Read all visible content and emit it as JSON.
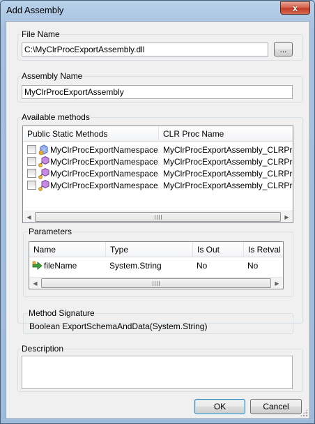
{
  "window": {
    "title": "Add Assembly",
    "close_glyph": "x"
  },
  "file_name": {
    "label": "File Name",
    "value": "C:\\MyClrProcExportAssembly.dll",
    "browse_label": "..."
  },
  "assembly_name": {
    "label": "Assembly Name",
    "value": "MyClrProcExportAssembly"
  },
  "available_methods": {
    "label": "Available methods",
    "columns": [
      "Public Static Methods",
      "CLR Proc Name"
    ],
    "rows": [
      {
        "method": "MyClrProcExportNamespace.C...",
        "proc": "MyClrProcExportAssembly_CLRProce...",
        "icon": "method-icon-blue",
        "checked": false
      },
      {
        "method": "MyClrProcExportNamespace.C...",
        "proc": "MyClrProcExportAssembly_CLRProce...",
        "icon": "method-icon-purple",
        "checked": false
      },
      {
        "method": "MyClrProcExportNamespace.C...",
        "proc": "MyClrProcExportAssembly_CLRProce...",
        "icon": "method-icon-purple",
        "checked": false
      },
      {
        "method": "MyClrProcExportNamespace.C...",
        "proc": "MyClrProcExportAssembly_CLRProce...",
        "icon": "method-icon-purple",
        "checked": false
      }
    ]
  },
  "parameters": {
    "label": "Parameters",
    "columns": [
      "Name",
      "Type",
      "Is Out",
      "Is Retval"
    ],
    "rows": [
      {
        "name": "fileName",
        "type": "System.String",
        "is_out": "No",
        "is_retval": "No",
        "icon": "parameter-arrow-icon"
      }
    ]
  },
  "method_signature": {
    "label": "Method Signature",
    "value": "Boolean ExportSchemaAndData(System.String)"
  },
  "description": {
    "label": "Description",
    "value": ""
  },
  "buttons": {
    "ok_label": "OK",
    "cancel_label": "Cancel"
  },
  "scrollbar": {
    "left_glyph": "◀",
    "right_glyph": "▶"
  }
}
